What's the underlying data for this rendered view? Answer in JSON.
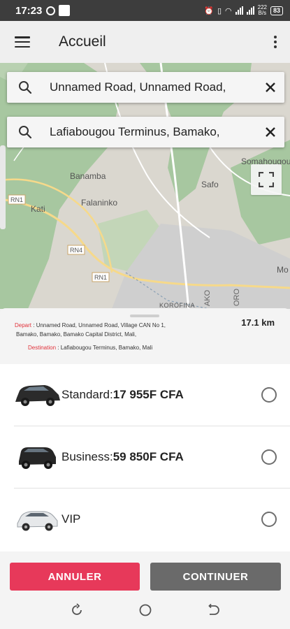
{
  "status_bar": {
    "time": "17:23",
    "network_top": "222",
    "network_bottom": "B/s",
    "battery": "83"
  },
  "app_bar": {
    "title": "Accueil",
    "menu_icon": "hamburger-icon",
    "more_icon": "more-vertical-icon"
  },
  "search": {
    "origin": "Unnamed Road, Unnamed Road,",
    "destination": "Lafiabougou Terminus, Bamako,",
    "search_icon": "search-icon",
    "clear_icon": "close-icon"
  },
  "map": {
    "labels": {
      "banamba": "Banamba",
      "somahougou": "Somahougou",
      "rn1_a": "RN1",
      "kati": "Kati",
      "falaninko": "Falaninko",
      "safo": "Safo",
      "rn4": "RN4",
      "rn1_b": "RN1",
      "mo": "Mo",
      "korofina": "KOROFINA",
      "ako": "AKO",
      "oro": "ORO"
    },
    "fullscreen_icon": "fullscreen-icon"
  },
  "route": {
    "depart_label": "Depart",
    "depart_line1": ": Unnamed Road, Unnamed Road, Village CAN No 1,",
    "depart_line2": "Bamako, Bamako, Bamako Capital District, Mali,",
    "destination_label": "Destination",
    "destination_value": ": Lafiabougou Terminus, Bamako, Mali",
    "distance": "17.1 km"
  },
  "ride_options": [
    {
      "name": "Standard:",
      "price": "17 955F CFA",
      "icon": "suv-car-icon"
    },
    {
      "name": "Business:",
      "price": "59 850F CFA",
      "icon": "suv-car-icon"
    },
    {
      "name": "VIP",
      "price": "",
      "icon": "white-suv-car-icon"
    }
  ],
  "actions": {
    "cancel_label": "ANNULER",
    "continue_label": "CONTINUER"
  },
  "colors": {
    "cancel": "#e7395a",
    "continue": "#6a6a6a",
    "accent_red": "#e0313a"
  }
}
